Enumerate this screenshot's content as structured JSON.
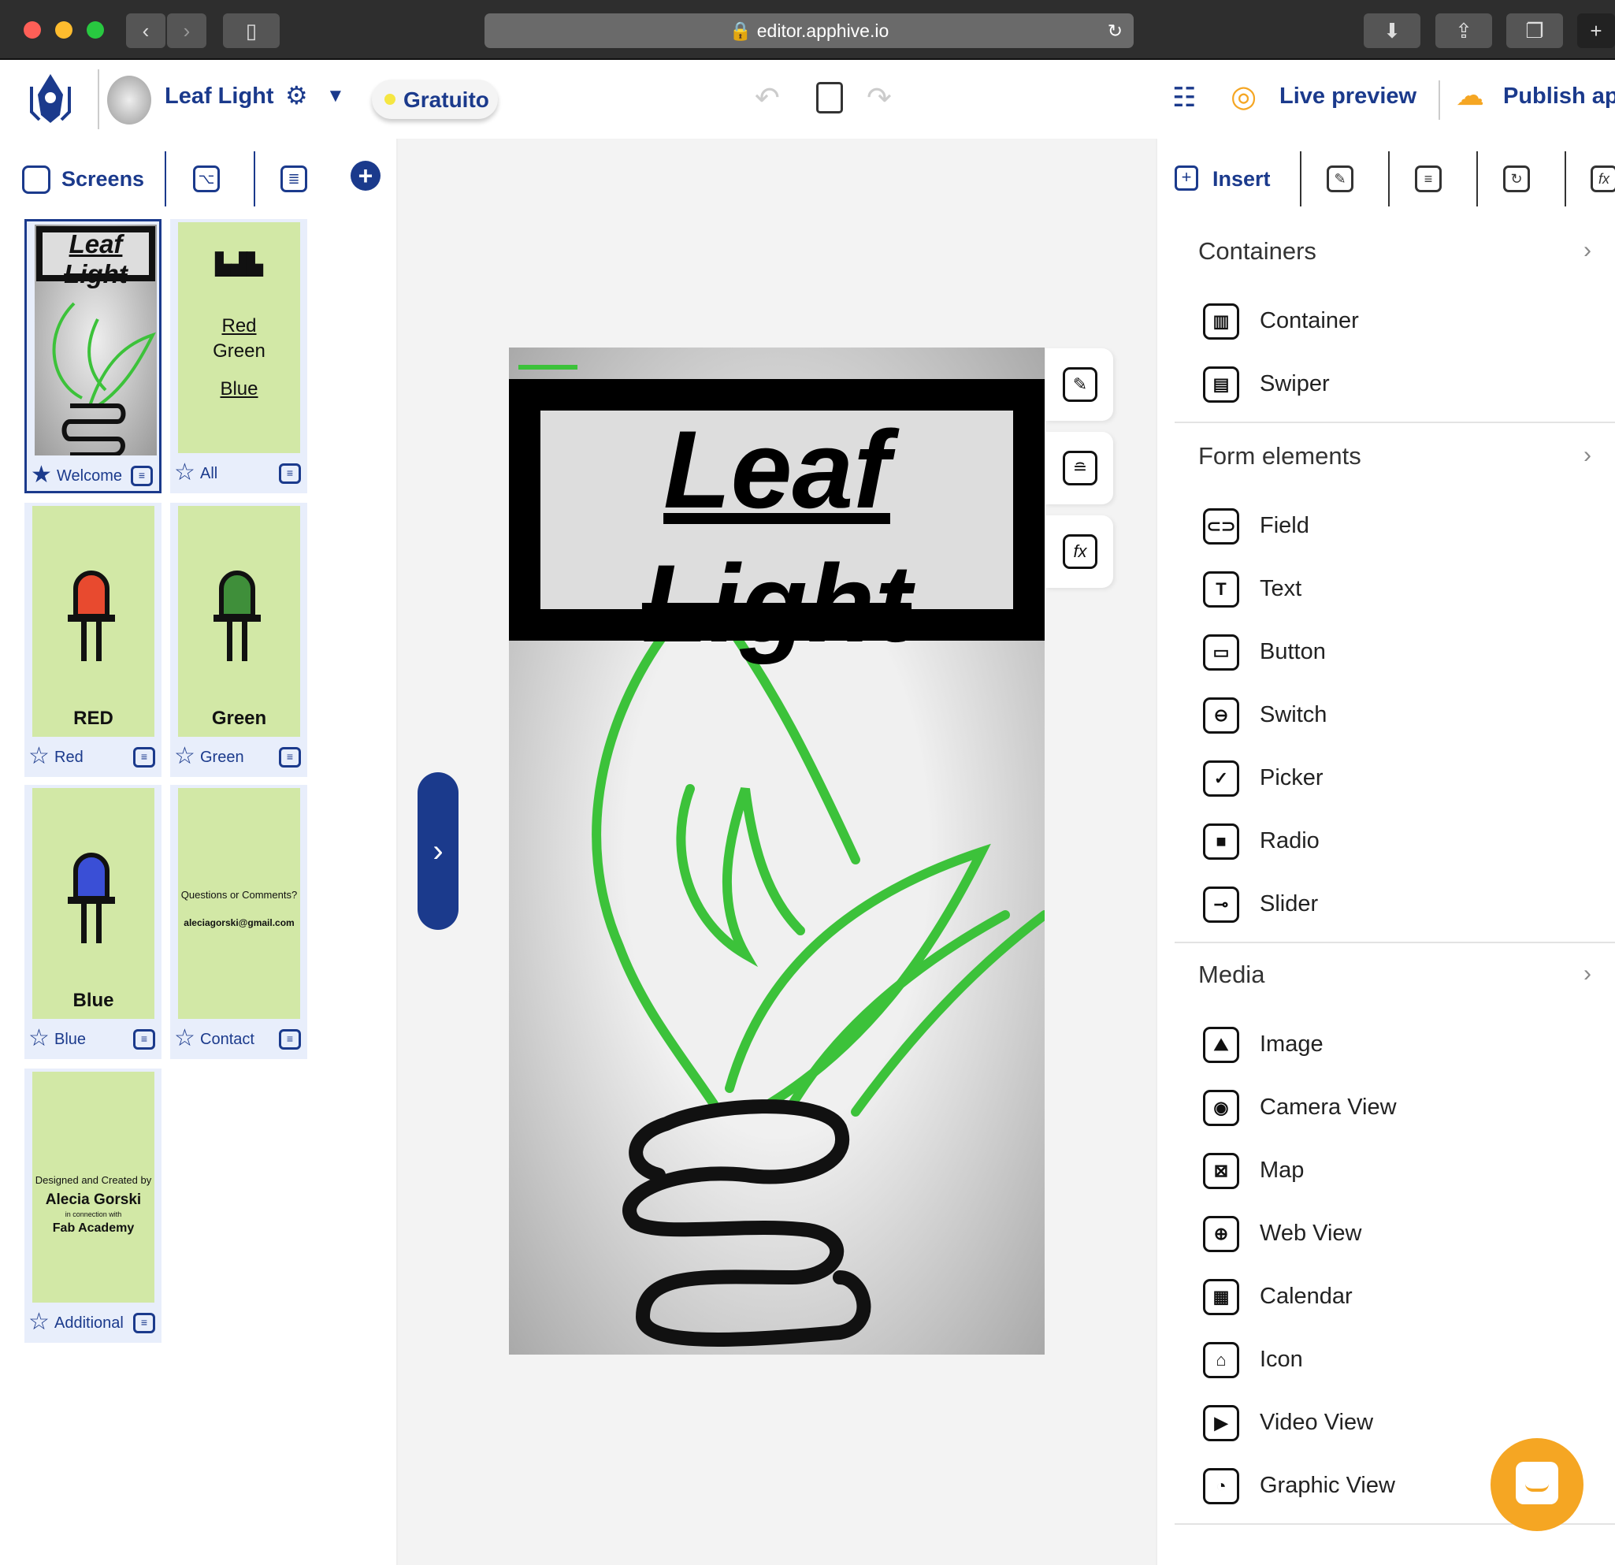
{
  "browser": {
    "url": "editor.apphive.io"
  },
  "header": {
    "app_name": "Leaf Light",
    "plan": "Gratuito",
    "live_preview": "Live preview",
    "publish": "Publish app"
  },
  "left_panel": {
    "tab_screens": "Screens"
  },
  "screens": [
    {
      "name": "Welcome",
      "starred": true,
      "selected": true,
      "preview": [
        "Leaf",
        "Light"
      ]
    },
    {
      "name": "All",
      "starred": false,
      "preview": [
        "Red",
        "Green",
        "Blue"
      ]
    },
    {
      "name": "Red",
      "starred": false,
      "preview": [
        "RED"
      ],
      "led_color": "#e84a2f"
    },
    {
      "name": "Green",
      "starred": false,
      "preview": [
        "Green"
      ],
      "led_color": "#3f8f3a"
    },
    {
      "name": "Blue",
      "starred": false,
      "preview": [
        "Blue"
      ],
      "led_color": "#3a4fd6"
    },
    {
      "name": "Contact",
      "starred": false,
      "preview": [
        "Questions or Comments?",
        "aleciagorski@gmail.com"
      ]
    },
    {
      "name": "Additional",
      "starred": false,
      "preview": [
        "Designed and Created by",
        "Alecia Gorski",
        "in connection with",
        "Fab Academy"
      ]
    }
  ],
  "phone": {
    "title_line1": "Leaf",
    "title_line2": "Light"
  },
  "right_panel": {
    "tab_insert": "Insert",
    "sections": [
      {
        "title": "Containers",
        "items": [
          {
            "label": "Container",
            "icon": "container-icon"
          },
          {
            "label": "Swiper",
            "icon": "swiper-icon"
          }
        ]
      },
      {
        "title": "Form elements",
        "items": [
          {
            "label": "Field",
            "icon": "field-icon"
          },
          {
            "label": "Text",
            "icon": "text-icon"
          },
          {
            "label": "Button",
            "icon": "button-icon"
          },
          {
            "label": "Switch",
            "icon": "switch-icon"
          },
          {
            "label": "Picker",
            "icon": "picker-icon"
          },
          {
            "label": "Radio",
            "icon": "radio-icon"
          },
          {
            "label": "Slider",
            "icon": "slider-icon"
          }
        ]
      },
      {
        "title": "Media",
        "items": [
          {
            "label": "Image",
            "icon": "image-icon"
          },
          {
            "label": "Camera View",
            "icon": "camera-icon"
          },
          {
            "label": "Map",
            "icon": "map-icon"
          },
          {
            "label": "Web View",
            "icon": "globe-icon"
          },
          {
            "label": "Calendar",
            "icon": "calendar-icon"
          },
          {
            "label": "Icon",
            "icon": "icon-icon"
          },
          {
            "label": "Video View",
            "icon": "video-icon"
          },
          {
            "label": "Graphic View",
            "icon": "chart-icon"
          }
        ]
      }
    ]
  },
  "colors": {
    "brand": "#1b3a8c",
    "accent": "#f5a623",
    "thumb_bg": "#d2e8a6",
    "leaf_green": "#3cc23a"
  }
}
